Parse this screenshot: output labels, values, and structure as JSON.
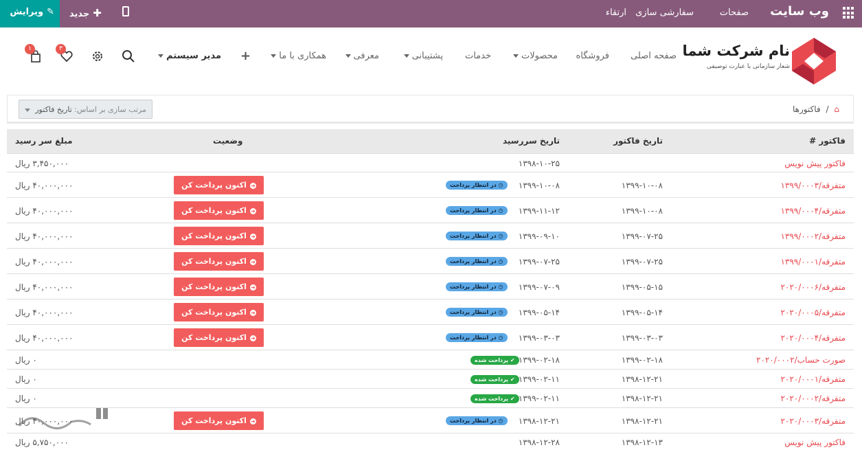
{
  "topbar": {
    "title": "وب سایت",
    "menu": [
      "صفحات",
      "سفارشی سازی",
      "ارتقاء"
    ],
    "new_label": "جدید",
    "edit_label": "ویرایش",
    "icons": [
      "apps-grid-icon",
      "mobile-icon",
      "plus-icon",
      "pencil-icon"
    ]
  },
  "nav": {
    "brand": "نام شرکت شما",
    "tagline": "شعار سازمانی با عبارت توصیفی",
    "items": [
      "صفحه اصلی",
      "فروشگاه",
      "محصولات",
      "خدمات",
      "پشتیبانی",
      "معرفی",
      "همکاری با ما"
    ],
    "user": "مدیر سیستم",
    "wishlist_count": "۳",
    "cart_count": "۱",
    "icons": [
      "search-icon",
      "gear-icon",
      "heart-icon",
      "cart-icon"
    ]
  },
  "breadcrumb": {
    "label": "فاکتورها",
    "icon": "home-icon"
  },
  "sort": {
    "label": "مرتب سازی بر اساس:",
    "value": "تاریخ فاکتور"
  },
  "table": {
    "headers": {
      "invoice": "فاکتور #",
      "date": "تاریخ فاکتور",
      "due": "تاریخ سررسید",
      "status": "وضعیت",
      "amount": "مبلغ سر رسید"
    },
    "pay_label": "اکنون پرداخت کن",
    "status_waiting": "در انتظار پرداخت",
    "status_paid": "پرداخت شده",
    "rows": [
      {
        "invoice": "فاکتور پیش نویس",
        "date": "",
        "due": "۱۳۹۸-۱۰-۲۵",
        "status": "",
        "amount": "۳,۴۵۰,۰۰۰ ریال",
        "pay": false
      },
      {
        "invoice": "متفرقه/۱۳۹۹/۰۰۰۳",
        "date": "۱۳۹۹-۱۰-۰۸",
        "due": "۱۳۹۹-۱۰-۰۸",
        "status": "waiting",
        "amount": "۴۰,۰۰۰,۰۰۰ ریال",
        "pay": true
      },
      {
        "invoice": "متفرقه/۱۳۹۹/۰۰۰۴",
        "date": "۱۳۹۹-۱۰-۰۸",
        "due": "۱۳۹۹-۱۱-۱۲",
        "status": "waiting",
        "amount": "۴۰,۰۰۰,۰۰۰ ریال",
        "pay": true
      },
      {
        "invoice": "متفرقه/۱۳۹۹/۰۰۰۲",
        "date": "۱۳۹۹-۰۷-۲۵",
        "due": "۱۳۹۹-۰۹-۱۰",
        "status": "waiting",
        "amount": "۴۰,۰۰۰,۰۰۰ ریال",
        "pay": true
      },
      {
        "invoice": "متفرقه/۱۳۹۹/۰۰۰۱",
        "date": "۱۳۹۹-۰۷-۲۵",
        "due": "۱۳۹۹-۰۷-۲۵",
        "status": "waiting",
        "amount": "۴۰,۰۰۰,۰۰۰ ریال",
        "pay": true
      },
      {
        "invoice": "متفرقه/۲۰۲۰/۰۰۰۶",
        "date": "۱۳۹۹-۰۵-۱۵",
        "due": "۱۳۹۹-۰۷-۰۹",
        "status": "waiting",
        "amount": "۴۰,۰۰۰,۰۰۰ ریال",
        "pay": true
      },
      {
        "invoice": "متفرقه/۲۰۲۰/۰۰۰۵",
        "date": "۱۳۹۹-۰۵-۱۴",
        "due": "۱۳۹۹-۰۵-۱۴",
        "status": "waiting",
        "amount": "۴۰,۰۰۰,۰۰۰ ریال",
        "pay": true
      },
      {
        "invoice": "متفرقه/۲۰۲۰/۰۰۰۴",
        "date": "۱۳۹۹-۰۳-۰۳",
        "due": "۱۳۹۹-۰۳-۰۳",
        "status": "waiting",
        "amount": "۴۰,۰۰۰,۰۰۰ ریال",
        "pay": true
      },
      {
        "invoice": "صورت حساب/۲۰۲۰/۰۰۰۲",
        "date": "۱۳۹۹-۰۲-۱۸",
        "due": "۱۳۹۹-۰۲-۱۸",
        "status": "paid",
        "amount": "۰ ریال",
        "pay": false
      },
      {
        "invoice": "متفرقه/۲۰۲۰/۰۰۰۱",
        "date": "۱۳۹۸-۱۲-۲۱",
        "due": "۱۳۹۹-۰۲-۱۱",
        "status": "paid",
        "amount": "۰ ریال",
        "pay": false
      },
      {
        "invoice": "متفرقه/۲۰۲۰/۰۰۰۲",
        "date": "۱۳۹۸-۱۲-۲۱",
        "due": "۱۳۹۹-۰۲-۱۱",
        "status": "paid",
        "amount": "۰ ریال",
        "pay": false
      },
      {
        "invoice": "متفرقه/۲۰۲۰/۰۰۰۳",
        "date": "۱۳۹۸-۱۲-۲۱",
        "due": "۱۳۹۸-۱۲-۲۱",
        "status": "waiting",
        "amount": "۴۰,۰۰۰,۰۰۰ ریال",
        "pay": true
      },
      {
        "invoice": "فاکتور پیش نویس",
        "date": "۱۳۹۸-۱۲-۱۳",
        "due": "۱۳۹۸-۱۲-۲۸",
        "status": "",
        "amount": "۵,۷۵۰,۰۰۰ ریال",
        "pay": false
      }
    ]
  },
  "colors": {
    "topbar": "#875a7b",
    "edit": "#00a09d",
    "accent": "#e8494f",
    "pay_button": "#f35c5c",
    "waiting": "#5aa7e6",
    "paid": "#28a745"
  }
}
